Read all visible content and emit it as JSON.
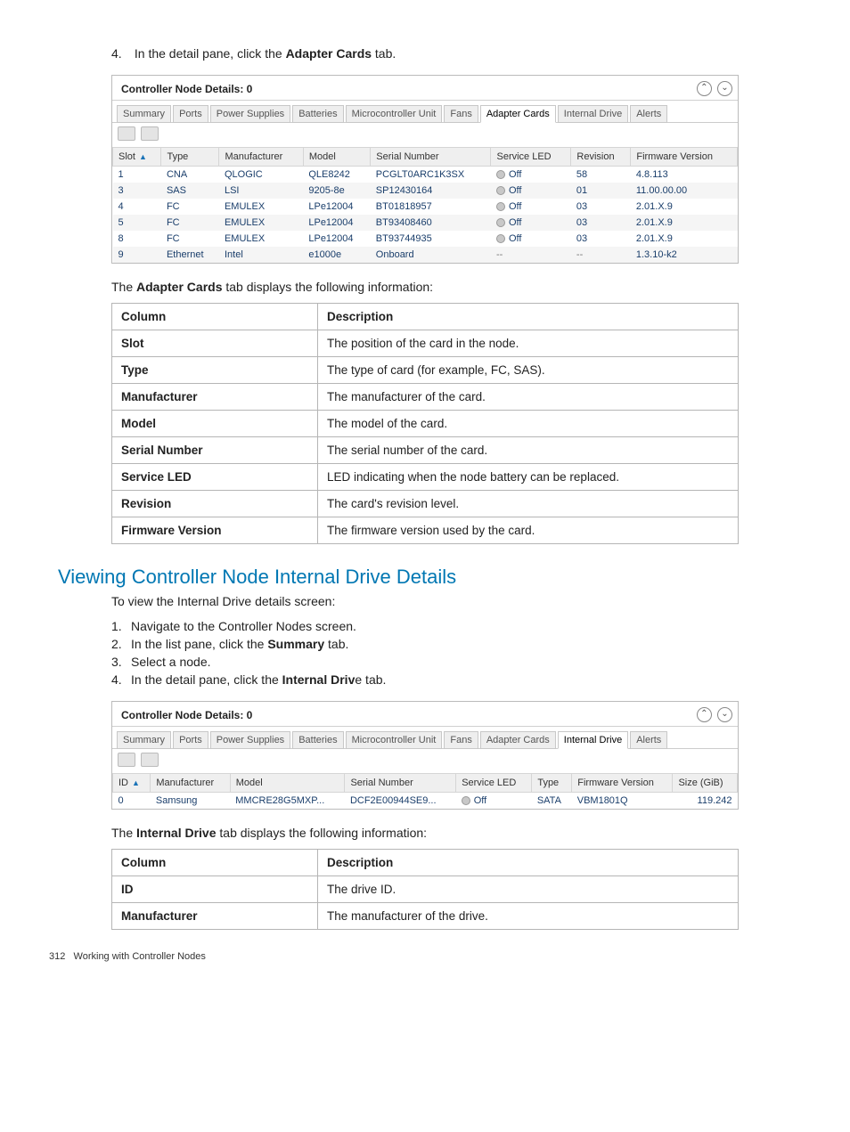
{
  "steps_top": [
    {
      "n": "4.",
      "pre": "In the detail pane, click the ",
      "bold": "Adapter Cards",
      "post": " tab."
    }
  ],
  "embed1": {
    "title": "Controller Node Details: 0",
    "tabs": [
      "Summary",
      "Ports",
      "Power Supplies",
      "Batteries",
      "Microcontroller Unit",
      "Fans",
      "Adapter Cards",
      "Internal Drive",
      "Alerts"
    ],
    "active_tab": "Adapter Cards",
    "headers": [
      "Slot",
      "Type",
      "Manufacturer",
      "Model",
      "Serial Number",
      "Service LED",
      "Revision",
      "Firmware Version"
    ],
    "rows": [
      {
        "slot": "1",
        "type": "CNA",
        "mfr": "QLOGIC",
        "model": "QLE8242",
        "serial": "PCGLT0ARC1K3SX",
        "led": "Off",
        "rev": "58",
        "fw": "4.8.113",
        "fwclass": ""
      },
      {
        "slot": "3",
        "type": "SAS",
        "mfr": "LSI",
        "model": "9205-8e",
        "serial": "SP12430164",
        "led": "Off",
        "rev": "01",
        "fw": "11.00.00.00",
        "fwclass": "fw-odd"
      },
      {
        "slot": "4",
        "type": "FC",
        "mfr": "EMULEX",
        "model": "LPe12004",
        "serial": "BT01818957",
        "led": "Off",
        "rev": "03",
        "fw": "2.01.X.9",
        "fwclass": ""
      },
      {
        "slot": "5",
        "type": "FC",
        "mfr": "EMULEX",
        "model": "LPe12004",
        "serial": "BT93408460",
        "led": "Off",
        "rev": "03",
        "fw": "2.01.X.9",
        "fwclass": ""
      },
      {
        "slot": "8",
        "type": "FC",
        "mfr": "EMULEX",
        "model": "LPe12004",
        "serial": "BT93744935",
        "led": "Off",
        "rev": "03",
        "fw": "2.01.X.9",
        "fwclass": ""
      },
      {
        "slot": "9",
        "type": "Ethernet",
        "mfr": "Intel",
        "model": "e1000e",
        "serial": "Onboard",
        "led": "--",
        "rev": "--",
        "fw": "1.3.10-k2",
        "fwclass": ""
      }
    ]
  },
  "adapter_intro_pre": "The ",
  "adapter_intro_bold": "Adapter Cards",
  "adapter_intro_post": "  tab displays the following information:",
  "adapter_desc_headers": [
    "Column",
    "Description"
  ],
  "adapter_desc_rows": [
    [
      "Slot",
      "The position of the card in the node."
    ],
    [
      "Type",
      "The type of card (for example, FC, SAS)."
    ],
    [
      "Manufacturer",
      "The manufacturer of the card."
    ],
    [
      "Model",
      "The model of the card."
    ],
    [
      "Serial Number",
      "The serial number of the card."
    ],
    [
      "Service LED",
      "LED indicating when the node battery can be replaced."
    ],
    [
      "Revision",
      "The card's revision level."
    ],
    [
      "Firmware Version",
      "The firmware version used by the card."
    ]
  ],
  "section_heading": "Viewing Controller Node Internal Drive Details",
  "internal_intro": "To view the Internal Drive details screen:",
  "steps_internal": [
    {
      "n": "1.",
      "text": "Navigate to the Controller Nodes screen."
    },
    {
      "n": "2.",
      "pre": "In the list pane, click the ",
      "bold": "Summary",
      "post": " tab."
    },
    {
      "n": "3.",
      "text": "Select a node."
    },
    {
      "n": "4.",
      "pre": "In the detail pane, click the ",
      "bold": "Internal Driv",
      "post": "e tab."
    }
  ],
  "embed2": {
    "title": "Controller Node Details: 0",
    "tabs": [
      "Summary",
      "Ports",
      "Power Supplies",
      "Batteries",
      "Microcontroller Unit",
      "Fans",
      "Adapter Cards",
      "Internal Drive",
      "Alerts"
    ],
    "active_tab": "Internal Drive",
    "headers": [
      "ID",
      "Manufacturer",
      "Model",
      "Serial Number",
      "Service LED",
      "Type",
      "Firmware Version",
      "Size (GiB)"
    ],
    "rows": [
      {
        "id": "0",
        "mfr": "Samsung",
        "model": "MMCRE28G5MXP...",
        "serial": "DCF2E00944SE9...",
        "led": "Off",
        "type": "SATA",
        "fw": "VBM1801Q",
        "size": "119.242"
      }
    ]
  },
  "internal_tab_intro_pre": "The ",
  "internal_tab_intro_bold": "Internal Drive",
  "internal_tab_intro_post": "  tab displays the following information:",
  "internal_desc_headers": [
    "Column",
    "Description"
  ],
  "internal_desc_rows": [
    [
      "ID",
      "The drive ID."
    ],
    [
      "Manufacturer",
      "The manufacturer of the drive."
    ]
  ],
  "footer_page": "312",
  "footer_text": "Working with Controller Nodes"
}
